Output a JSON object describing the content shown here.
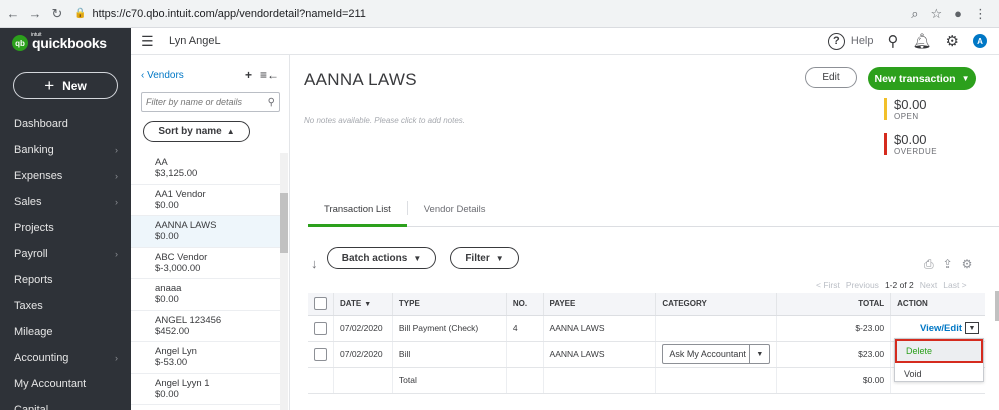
{
  "browser": {
    "url": "https://c70.qbo.intuit.com/app/vendordetail?nameId=211"
  },
  "leftnav": {
    "logo_mark": "qb",
    "logo_sup": "intuit",
    "logo_text": "quickbooks",
    "new_label": "New",
    "items": [
      {
        "label": "Dashboard",
        "chevron": false
      },
      {
        "label": "Banking",
        "chevron": true
      },
      {
        "label": "Expenses",
        "chevron": true
      },
      {
        "label": "Sales",
        "chevron": true
      },
      {
        "label": "Projects",
        "chevron": false
      },
      {
        "label": "Payroll",
        "chevron": true
      },
      {
        "label": "Reports",
        "chevron": false
      },
      {
        "label": "Taxes",
        "chevron": false
      },
      {
        "label": "Mileage",
        "chevron": false
      },
      {
        "label": "Accounting",
        "chevron": true
      },
      {
        "label": "My Accountant",
        "chevron": false
      },
      {
        "label": "Capital",
        "chevron": false
      }
    ]
  },
  "header": {
    "company": "Lyn AngeL",
    "help_label": "Help",
    "avatar_letter": "A"
  },
  "vendors": {
    "back_label": "Vendors",
    "search_placeholder": "Filter by name or details",
    "sort_label": "Sort by name",
    "items": [
      {
        "name": "AA",
        "balance": "$3,125.00"
      },
      {
        "name": "AA1 Vendor",
        "balance": "$0.00"
      },
      {
        "name": "AANNA LAWS",
        "balance": "$0.00"
      },
      {
        "name": "ABC Vendor",
        "balance": "$-3,000.00"
      },
      {
        "name": "anaaa",
        "balance": "$0.00"
      },
      {
        "name": "ANGEL 123456",
        "balance": "$452.00"
      },
      {
        "name": "Angel Lyn",
        "balance": "$-53.00"
      },
      {
        "name": "Angel Lyyn 1",
        "balance": "$0.00"
      }
    ]
  },
  "main": {
    "title": "AANNA LAWS",
    "edit_label": "Edit",
    "new_tx_label": "New transaction",
    "notes_placeholder": "No notes available. Please click to add notes.",
    "open_amount": "$0.00",
    "open_label": "OPEN",
    "overdue_amount": "$0.00",
    "overdue_label": "OVERDUE",
    "tabs": [
      {
        "label": "Transaction List"
      },
      {
        "label": "Vendor Details"
      }
    ],
    "batch_label": "Batch actions",
    "filter_label": "Filter",
    "pager": {
      "first": "< First",
      "previous": "Previous",
      "range": "1-2 of 2",
      "next": "Next",
      "last": "Last >"
    },
    "columns": {
      "date": "DATE",
      "type": "TYPE",
      "no": "NO.",
      "payee": "PAYEE",
      "category": "CATEGORY",
      "total": "TOTAL",
      "action": "ACTION"
    },
    "rows": [
      {
        "date": "07/02/2020",
        "type": "Bill Payment (Check)",
        "no": "4",
        "payee": "AANNA LAWS",
        "category": "",
        "total": "$-23.00",
        "action": "View/Edit"
      },
      {
        "date": "07/02/2020",
        "type": "Bill",
        "no": "",
        "payee": "AANNA LAWS",
        "category": "Ask My Accountant",
        "total": "$23.00",
        "action": ""
      }
    ],
    "total_row": {
      "label": "Total",
      "total": "$0.00"
    },
    "menu": {
      "delete_label": "Delete",
      "void_label": "Void"
    }
  },
  "colors": {
    "brand_green": "#2ca01c",
    "nav_bg": "#2e3238",
    "link_blue": "#0077c5",
    "open_bar": "#f2c02a",
    "overdue_bar": "#d52b1e",
    "highlight_border": "#d52b1e"
  }
}
